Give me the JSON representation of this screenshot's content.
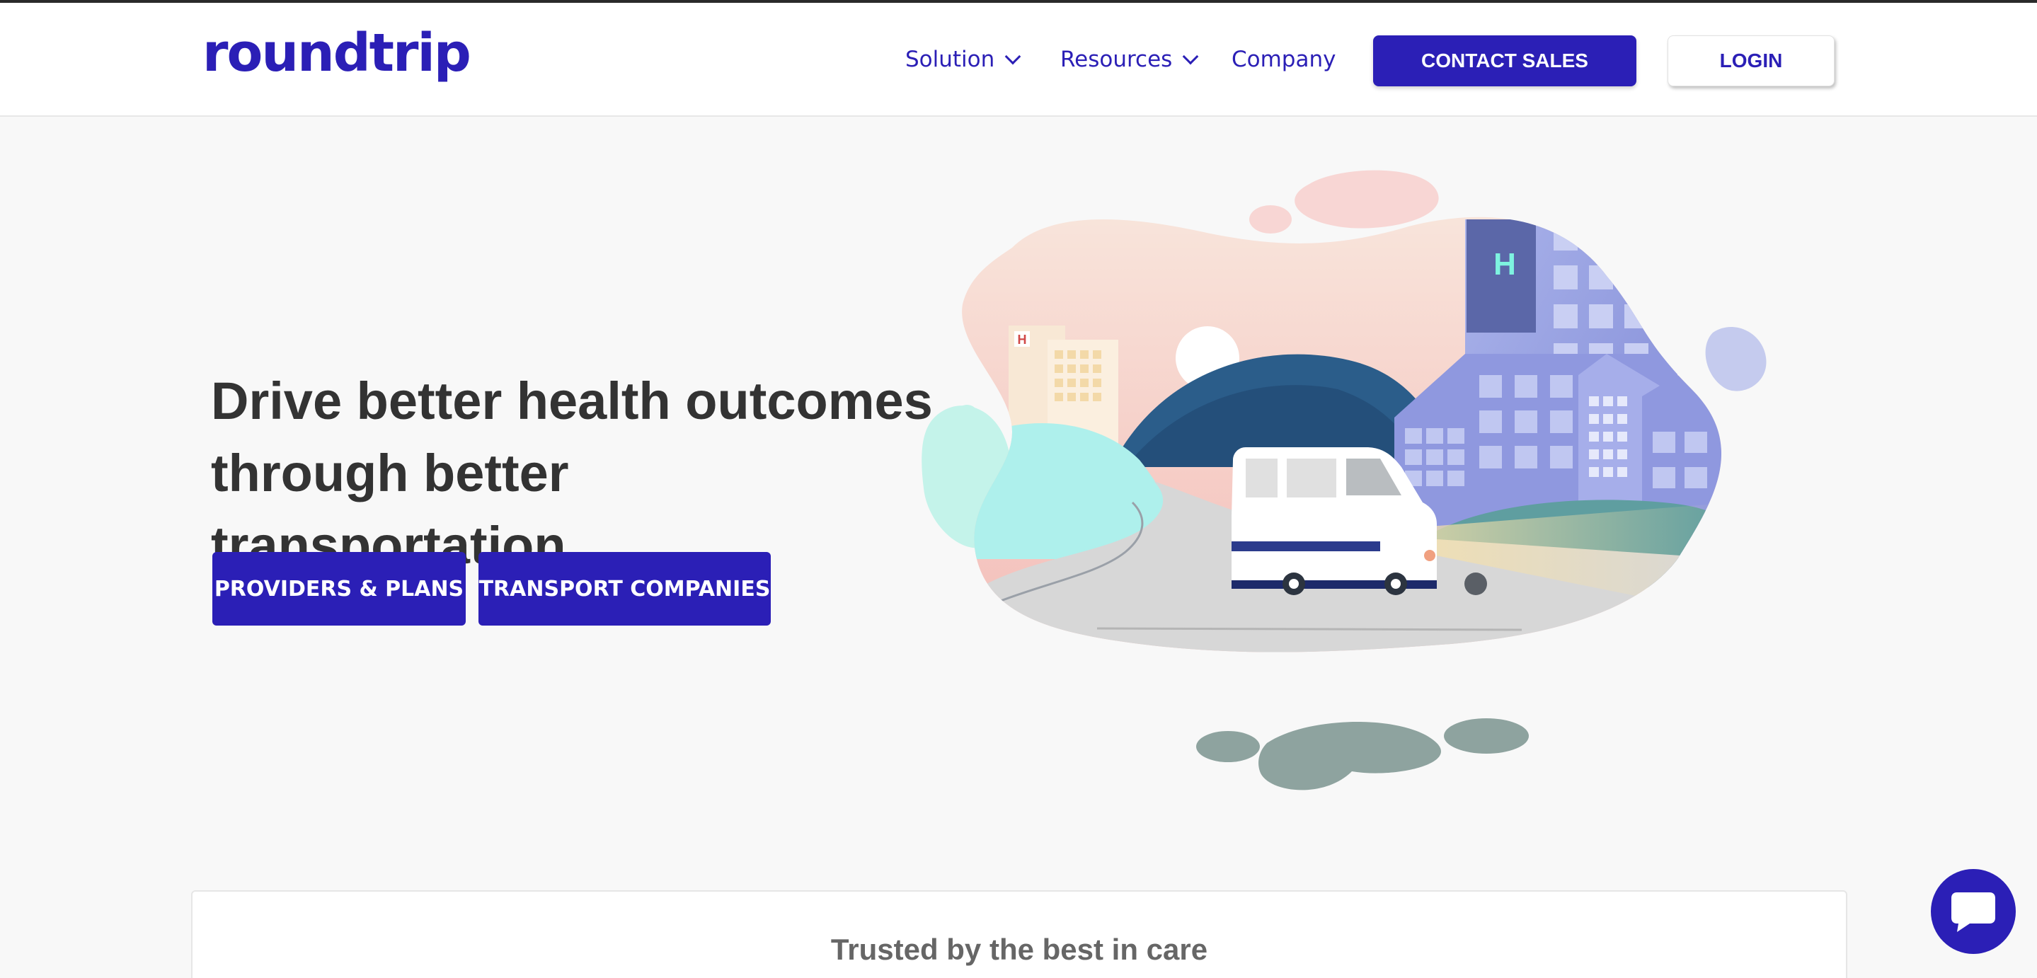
{
  "brand": {
    "logo_text": "roundtrip",
    "accent": "#2b1fb6"
  },
  "nav": {
    "items": [
      {
        "label": "Solution",
        "has_dropdown": true
      },
      {
        "label": "Resources",
        "has_dropdown": true
      },
      {
        "label": "Company",
        "has_dropdown": false
      }
    ],
    "contact_label": "CONTACT SALES",
    "login_label": "LOGIN"
  },
  "hero": {
    "headline_line1": "Drive better health outcomes",
    "headline_line2": "through better transportation.",
    "cta_providers": "PROVIDERS & PLANS",
    "cta_transport": "TRANSPORT COMPANIES",
    "illustration": {
      "sign_letter_left": "H",
      "sign_letter_right": "H"
    }
  },
  "trusted": {
    "title": "Trusted by the best in care"
  },
  "chat": {
    "icon": "chat-bubble-icon"
  }
}
